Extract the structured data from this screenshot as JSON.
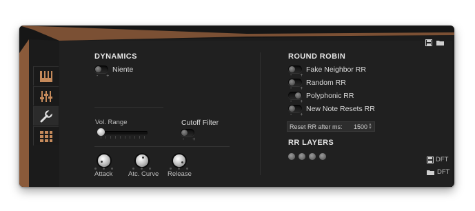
{
  "dynamics": {
    "heading": "DYNAMICS",
    "mode_label": "Niente",
    "vol_range_label": "Vol. Range",
    "cutoff_filter_label": "Cutoff Filter",
    "vol_range_value": 0.0,
    "knobs": [
      {
        "label": "Attack"
      },
      {
        "label": "Atc. Curve"
      },
      {
        "label": "Release"
      }
    ]
  },
  "round_robin": {
    "heading": "ROUND ROBIN",
    "options": [
      {
        "label": "Fake Neighbor RR",
        "on": false
      },
      {
        "label": "Random RR",
        "on": false
      },
      {
        "label": "Polyphonic RR",
        "on": true
      },
      {
        "label": "New Note Resets RR",
        "on": false
      }
    ],
    "reset_label": "Reset RR after ms:",
    "reset_value": "1500",
    "layers_heading": "RR LAYERS",
    "layers_count": 4
  },
  "pm": "- +",
  "presets": [
    {
      "label": "DFT"
    },
    {
      "label": "DFT"
    }
  ],
  "tabs": [
    "piano-keys",
    "mixer",
    "wrench",
    "grid"
  ],
  "colors": {
    "wood": "#8a5a3a",
    "panel": "#202020",
    "text": "#dcdcdc"
  }
}
